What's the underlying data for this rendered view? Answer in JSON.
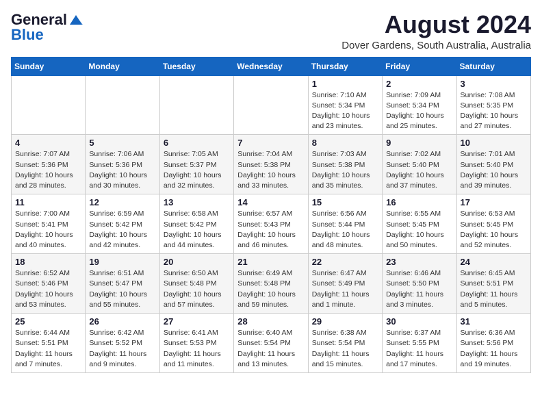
{
  "header": {
    "logo_general": "General",
    "logo_blue": "Blue",
    "month_year": "August 2024",
    "location": "Dover Gardens, South Australia, Australia"
  },
  "weekdays": [
    "Sunday",
    "Monday",
    "Tuesday",
    "Wednesday",
    "Thursday",
    "Friday",
    "Saturday"
  ],
  "weeks": [
    [
      {
        "day": "",
        "info": ""
      },
      {
        "day": "",
        "info": ""
      },
      {
        "day": "",
        "info": ""
      },
      {
        "day": "",
        "info": ""
      },
      {
        "day": "1",
        "info": "Sunrise: 7:10 AM\nSunset: 5:34 PM\nDaylight: 10 hours\nand 23 minutes."
      },
      {
        "day": "2",
        "info": "Sunrise: 7:09 AM\nSunset: 5:34 PM\nDaylight: 10 hours\nand 25 minutes."
      },
      {
        "day": "3",
        "info": "Sunrise: 7:08 AM\nSunset: 5:35 PM\nDaylight: 10 hours\nand 27 minutes."
      }
    ],
    [
      {
        "day": "4",
        "info": "Sunrise: 7:07 AM\nSunset: 5:36 PM\nDaylight: 10 hours\nand 28 minutes."
      },
      {
        "day": "5",
        "info": "Sunrise: 7:06 AM\nSunset: 5:36 PM\nDaylight: 10 hours\nand 30 minutes."
      },
      {
        "day": "6",
        "info": "Sunrise: 7:05 AM\nSunset: 5:37 PM\nDaylight: 10 hours\nand 32 minutes."
      },
      {
        "day": "7",
        "info": "Sunrise: 7:04 AM\nSunset: 5:38 PM\nDaylight: 10 hours\nand 33 minutes."
      },
      {
        "day": "8",
        "info": "Sunrise: 7:03 AM\nSunset: 5:38 PM\nDaylight: 10 hours\nand 35 minutes."
      },
      {
        "day": "9",
        "info": "Sunrise: 7:02 AM\nSunset: 5:40 PM\nDaylight: 10 hours\nand 37 minutes."
      },
      {
        "day": "10",
        "info": "Sunrise: 7:01 AM\nSunset: 5:40 PM\nDaylight: 10 hours\nand 39 minutes."
      }
    ],
    [
      {
        "day": "11",
        "info": "Sunrise: 7:00 AM\nSunset: 5:41 PM\nDaylight: 10 hours\nand 40 minutes."
      },
      {
        "day": "12",
        "info": "Sunrise: 6:59 AM\nSunset: 5:42 PM\nDaylight: 10 hours\nand 42 minutes."
      },
      {
        "day": "13",
        "info": "Sunrise: 6:58 AM\nSunset: 5:42 PM\nDaylight: 10 hours\nand 44 minutes."
      },
      {
        "day": "14",
        "info": "Sunrise: 6:57 AM\nSunset: 5:43 PM\nDaylight: 10 hours\nand 46 minutes."
      },
      {
        "day": "15",
        "info": "Sunrise: 6:56 AM\nSunset: 5:44 PM\nDaylight: 10 hours\nand 48 minutes."
      },
      {
        "day": "16",
        "info": "Sunrise: 6:55 AM\nSunset: 5:45 PM\nDaylight: 10 hours\nand 50 minutes."
      },
      {
        "day": "17",
        "info": "Sunrise: 6:53 AM\nSunset: 5:45 PM\nDaylight: 10 hours\nand 52 minutes."
      }
    ],
    [
      {
        "day": "18",
        "info": "Sunrise: 6:52 AM\nSunset: 5:46 PM\nDaylight: 10 hours\nand 53 minutes."
      },
      {
        "day": "19",
        "info": "Sunrise: 6:51 AM\nSunset: 5:47 PM\nDaylight: 10 hours\nand 55 minutes."
      },
      {
        "day": "20",
        "info": "Sunrise: 6:50 AM\nSunset: 5:48 PM\nDaylight: 10 hours\nand 57 minutes."
      },
      {
        "day": "21",
        "info": "Sunrise: 6:49 AM\nSunset: 5:48 PM\nDaylight: 10 hours\nand 59 minutes."
      },
      {
        "day": "22",
        "info": "Sunrise: 6:47 AM\nSunset: 5:49 PM\nDaylight: 11 hours\nand 1 minute."
      },
      {
        "day": "23",
        "info": "Sunrise: 6:46 AM\nSunset: 5:50 PM\nDaylight: 11 hours\nand 3 minutes."
      },
      {
        "day": "24",
        "info": "Sunrise: 6:45 AM\nSunset: 5:51 PM\nDaylight: 11 hours\nand 5 minutes."
      }
    ],
    [
      {
        "day": "25",
        "info": "Sunrise: 6:44 AM\nSunset: 5:51 PM\nDaylight: 11 hours\nand 7 minutes."
      },
      {
        "day": "26",
        "info": "Sunrise: 6:42 AM\nSunset: 5:52 PM\nDaylight: 11 hours\nand 9 minutes."
      },
      {
        "day": "27",
        "info": "Sunrise: 6:41 AM\nSunset: 5:53 PM\nDaylight: 11 hours\nand 11 minutes."
      },
      {
        "day": "28",
        "info": "Sunrise: 6:40 AM\nSunset: 5:54 PM\nDaylight: 11 hours\nand 13 minutes."
      },
      {
        "day": "29",
        "info": "Sunrise: 6:38 AM\nSunset: 5:54 PM\nDaylight: 11 hours\nand 15 minutes."
      },
      {
        "day": "30",
        "info": "Sunrise: 6:37 AM\nSunset: 5:55 PM\nDaylight: 11 hours\nand 17 minutes."
      },
      {
        "day": "31",
        "info": "Sunrise: 6:36 AM\nSunset: 5:56 PM\nDaylight: 11 hours\nand 19 minutes."
      }
    ]
  ]
}
